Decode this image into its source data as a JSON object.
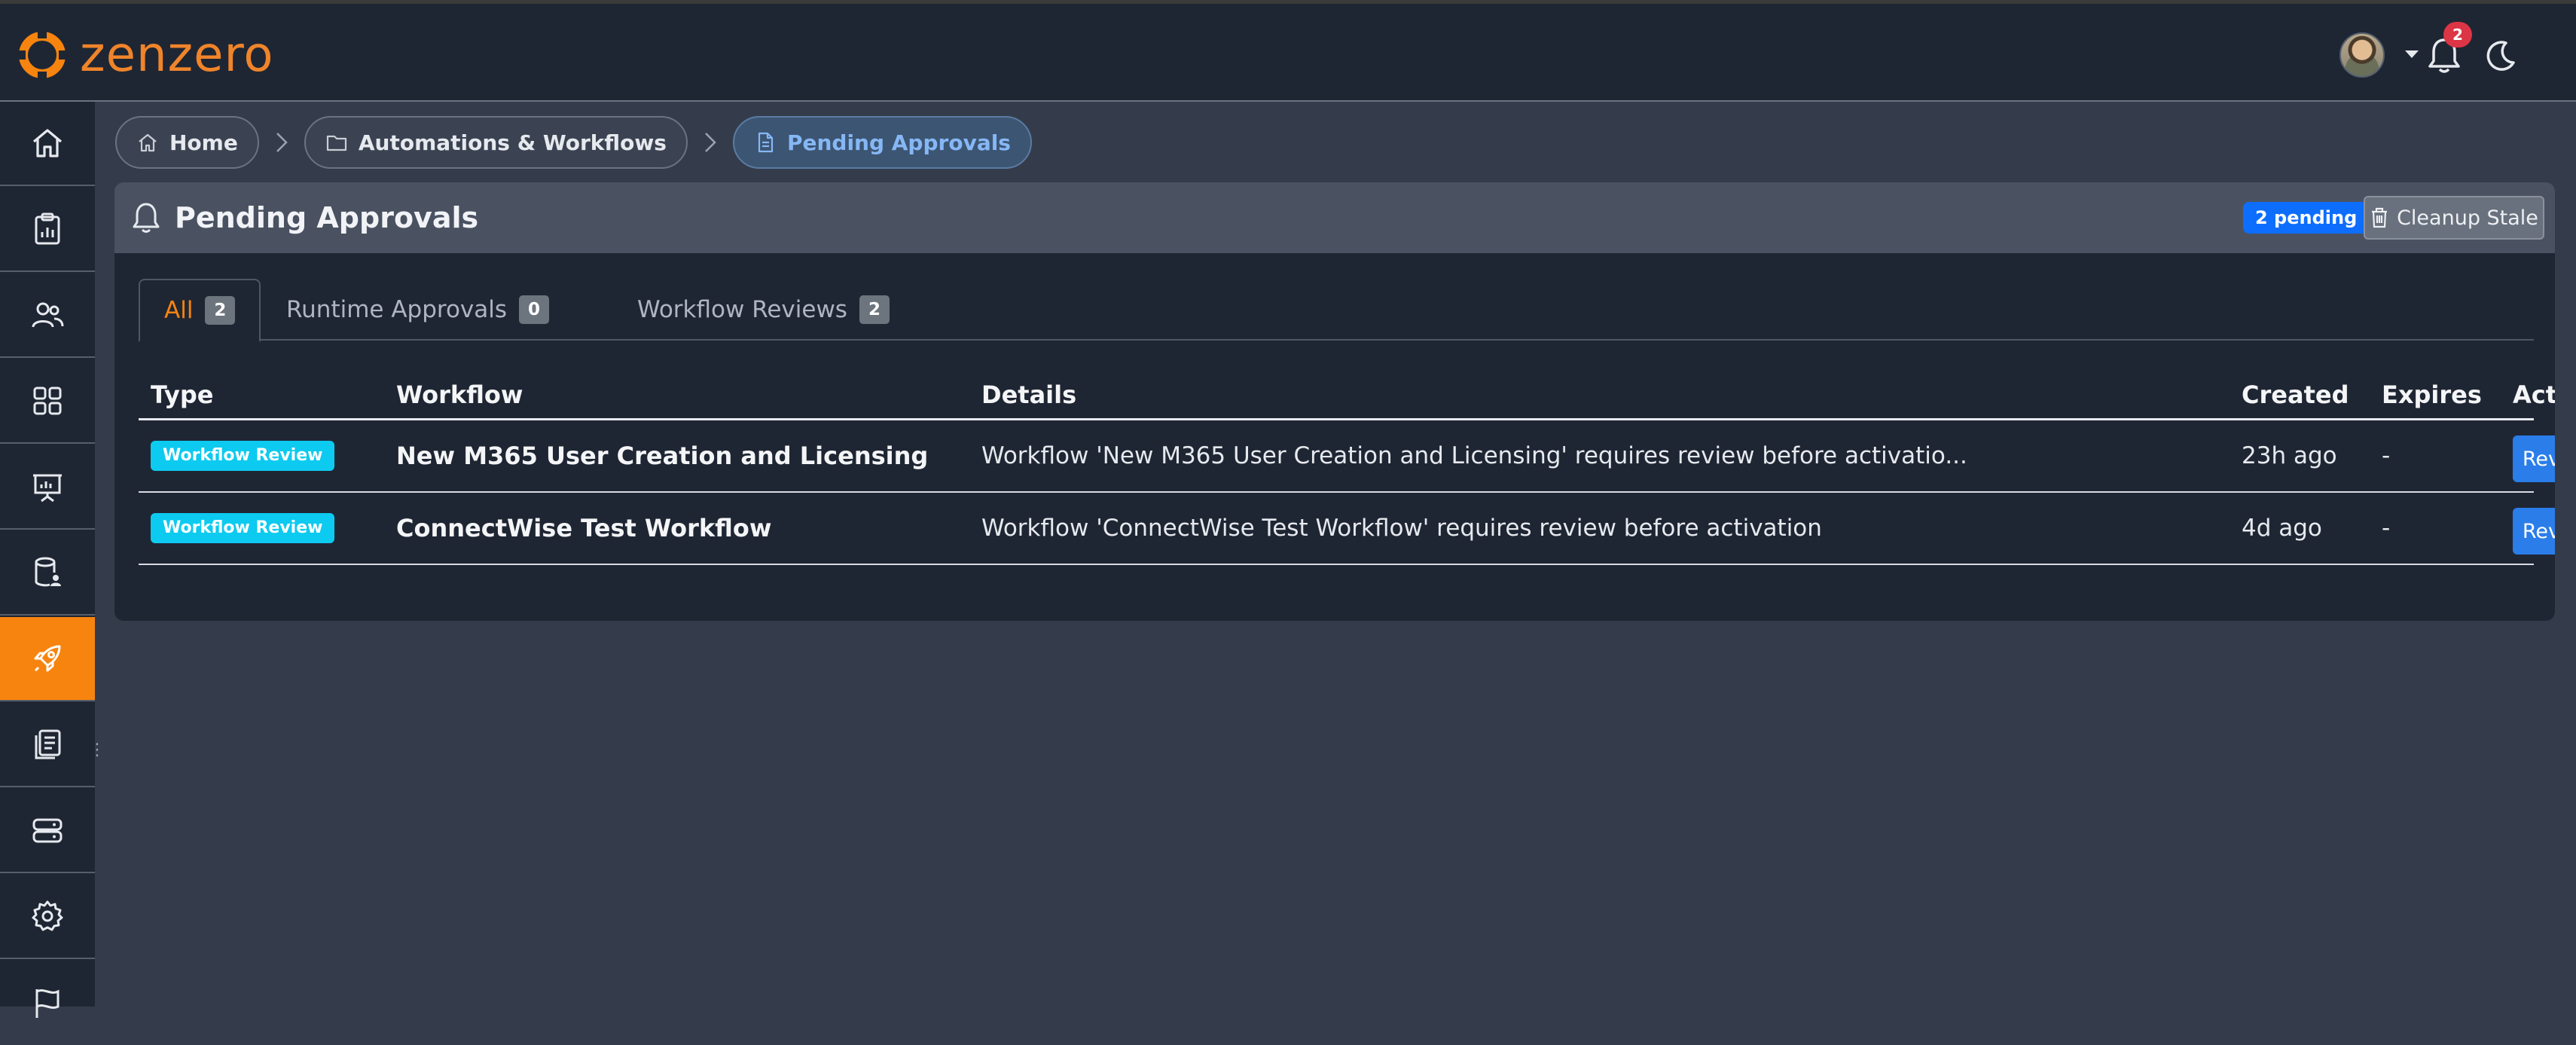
{
  "app": {
    "name": "zenzero",
    "notification_count": "2",
    "colors": {
      "brand": "#f7840f",
      "primary": "#0d6efd",
      "info": "#0dcaf0",
      "danger": "#dc3545"
    }
  },
  "sidebar": {
    "items": [
      {
        "icon": "home-icon"
      },
      {
        "icon": "clipboard-chart-icon"
      },
      {
        "icon": "users-icon"
      },
      {
        "icon": "grid-icon"
      },
      {
        "icon": "presentation-icon"
      },
      {
        "icon": "database-user-icon"
      },
      {
        "icon": "rocket-icon",
        "active": true
      },
      {
        "icon": "documents-icon"
      },
      {
        "icon": "servers-icon"
      },
      {
        "icon": "gear-icon"
      },
      {
        "icon": "flag-icon"
      }
    ]
  },
  "breadcrumb": {
    "items": [
      {
        "label": "Home",
        "icon": "home-icon"
      },
      {
        "label": "Automations & Workflows",
        "icon": "folder-icon"
      },
      {
        "label": "Pending Approvals",
        "icon": "document-icon"
      }
    ]
  },
  "card": {
    "title": "Pending Approvals",
    "pending_badge": "2 pending",
    "cleanup_label": "Cleanup Stale"
  },
  "tabs": [
    {
      "label": "All",
      "count": "2",
      "active": true
    },
    {
      "label": "Runtime Approvals",
      "count": "0"
    },
    {
      "label": "Workflow Reviews",
      "count": "2"
    }
  ],
  "table": {
    "headers": [
      "Type",
      "Workflow",
      "Details",
      "Created",
      "Expires",
      "Action"
    ],
    "rows": [
      {
        "type": "Workflow Review",
        "workflow": "New M365 User Creation and Licensing",
        "details": "Workflow 'New M365 User Creation and Licensing' requires review before activatio...",
        "created": "23h ago",
        "expires": "-",
        "action": "Review"
      },
      {
        "type": "Workflow Review",
        "workflow": "ConnectWise Test Workflow",
        "details": "Workflow 'ConnectWise Test Workflow' requires review before activation",
        "created": "4d ago",
        "expires": "-",
        "action": "Review"
      }
    ]
  }
}
